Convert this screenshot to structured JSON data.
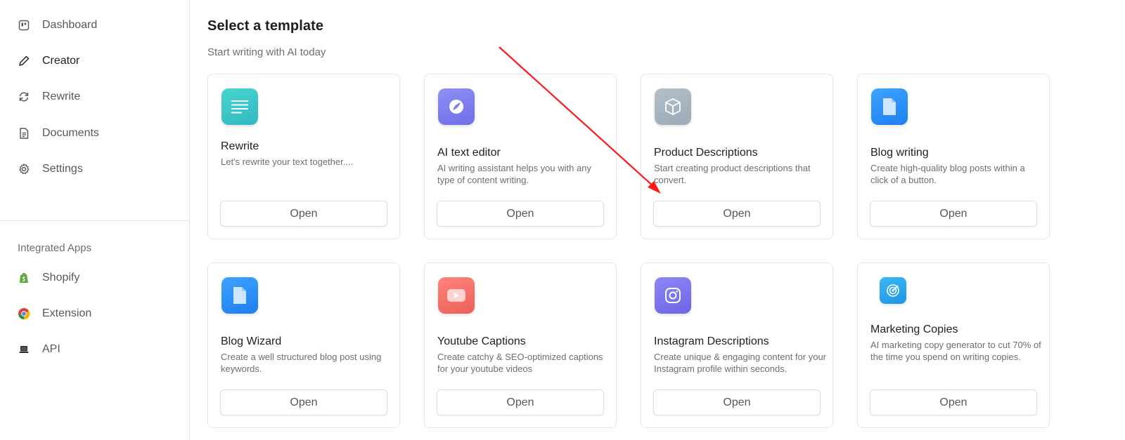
{
  "sidebar": {
    "nav": [
      {
        "label": "Dashboard",
        "icon": "dashboard-icon"
      },
      {
        "label": "Creator",
        "icon": "pencil-icon"
      },
      {
        "label": "Rewrite",
        "icon": "refresh-icon"
      },
      {
        "label": "Documents",
        "icon": "document-icon"
      },
      {
        "label": "Settings",
        "icon": "gear-icon"
      }
    ],
    "integrated_label": "Integrated Apps",
    "apps": [
      {
        "label": "Shopify",
        "icon": "shopify-icon"
      },
      {
        "label": "Extension",
        "icon": "chrome-icon"
      },
      {
        "label": "API",
        "icon": "laptop-icon"
      }
    ]
  },
  "main": {
    "title": "Select a template",
    "subtitle": "Start writing with AI today",
    "cards": [
      {
        "title": "Rewrite",
        "desc": "Let's rewrite your text together....",
        "button": "Open",
        "icon": "lines-icon"
      },
      {
        "title": "AI text editor",
        "desc": "AI writing assistant helps you with any type of content writing.",
        "button": "Open",
        "icon": "leaf-icon"
      },
      {
        "title": "Product Descriptions",
        "desc": "Start creating product descriptions that convert.",
        "button": "Open",
        "icon": "box-icon"
      },
      {
        "title": "Blog writing",
        "desc": "Create high-quality blog posts within a click of a button.",
        "button": "Open",
        "icon": "file-icon"
      },
      {
        "title": "Blog Wizard",
        "desc": "Create a well structured blog post using keywords.",
        "button": "Open",
        "icon": "file-icon"
      },
      {
        "title": "Youtube Captions",
        "desc": "Create catchy & SEO-optimized captions for your youtube videos",
        "button": "Open",
        "icon": "youtube-icon"
      },
      {
        "title": "Instagram Descriptions",
        "desc": "Create unique & engaging content for your Instagram profile within seconds.",
        "button": "Open",
        "icon": "instagram-icon"
      },
      {
        "title": "Marketing Copies",
        "desc": "AI marketing copy generator to cut 70% of the time you spend on writing copies.",
        "button": "Open",
        "icon": "target-icon"
      }
    ]
  },
  "colors": {
    "arrow": "#ff1a1a",
    "rewrite_icon": "#3fc9c6",
    "ai_editor_icon": "#7b7ff0",
    "product_icon": "#a9b7c2",
    "blog_icon": "#2f8ff5",
    "youtube_icon": "#f4716a",
    "instagram_icon": "#7d74ef",
    "marketing_icon": "#29a6ee"
  }
}
